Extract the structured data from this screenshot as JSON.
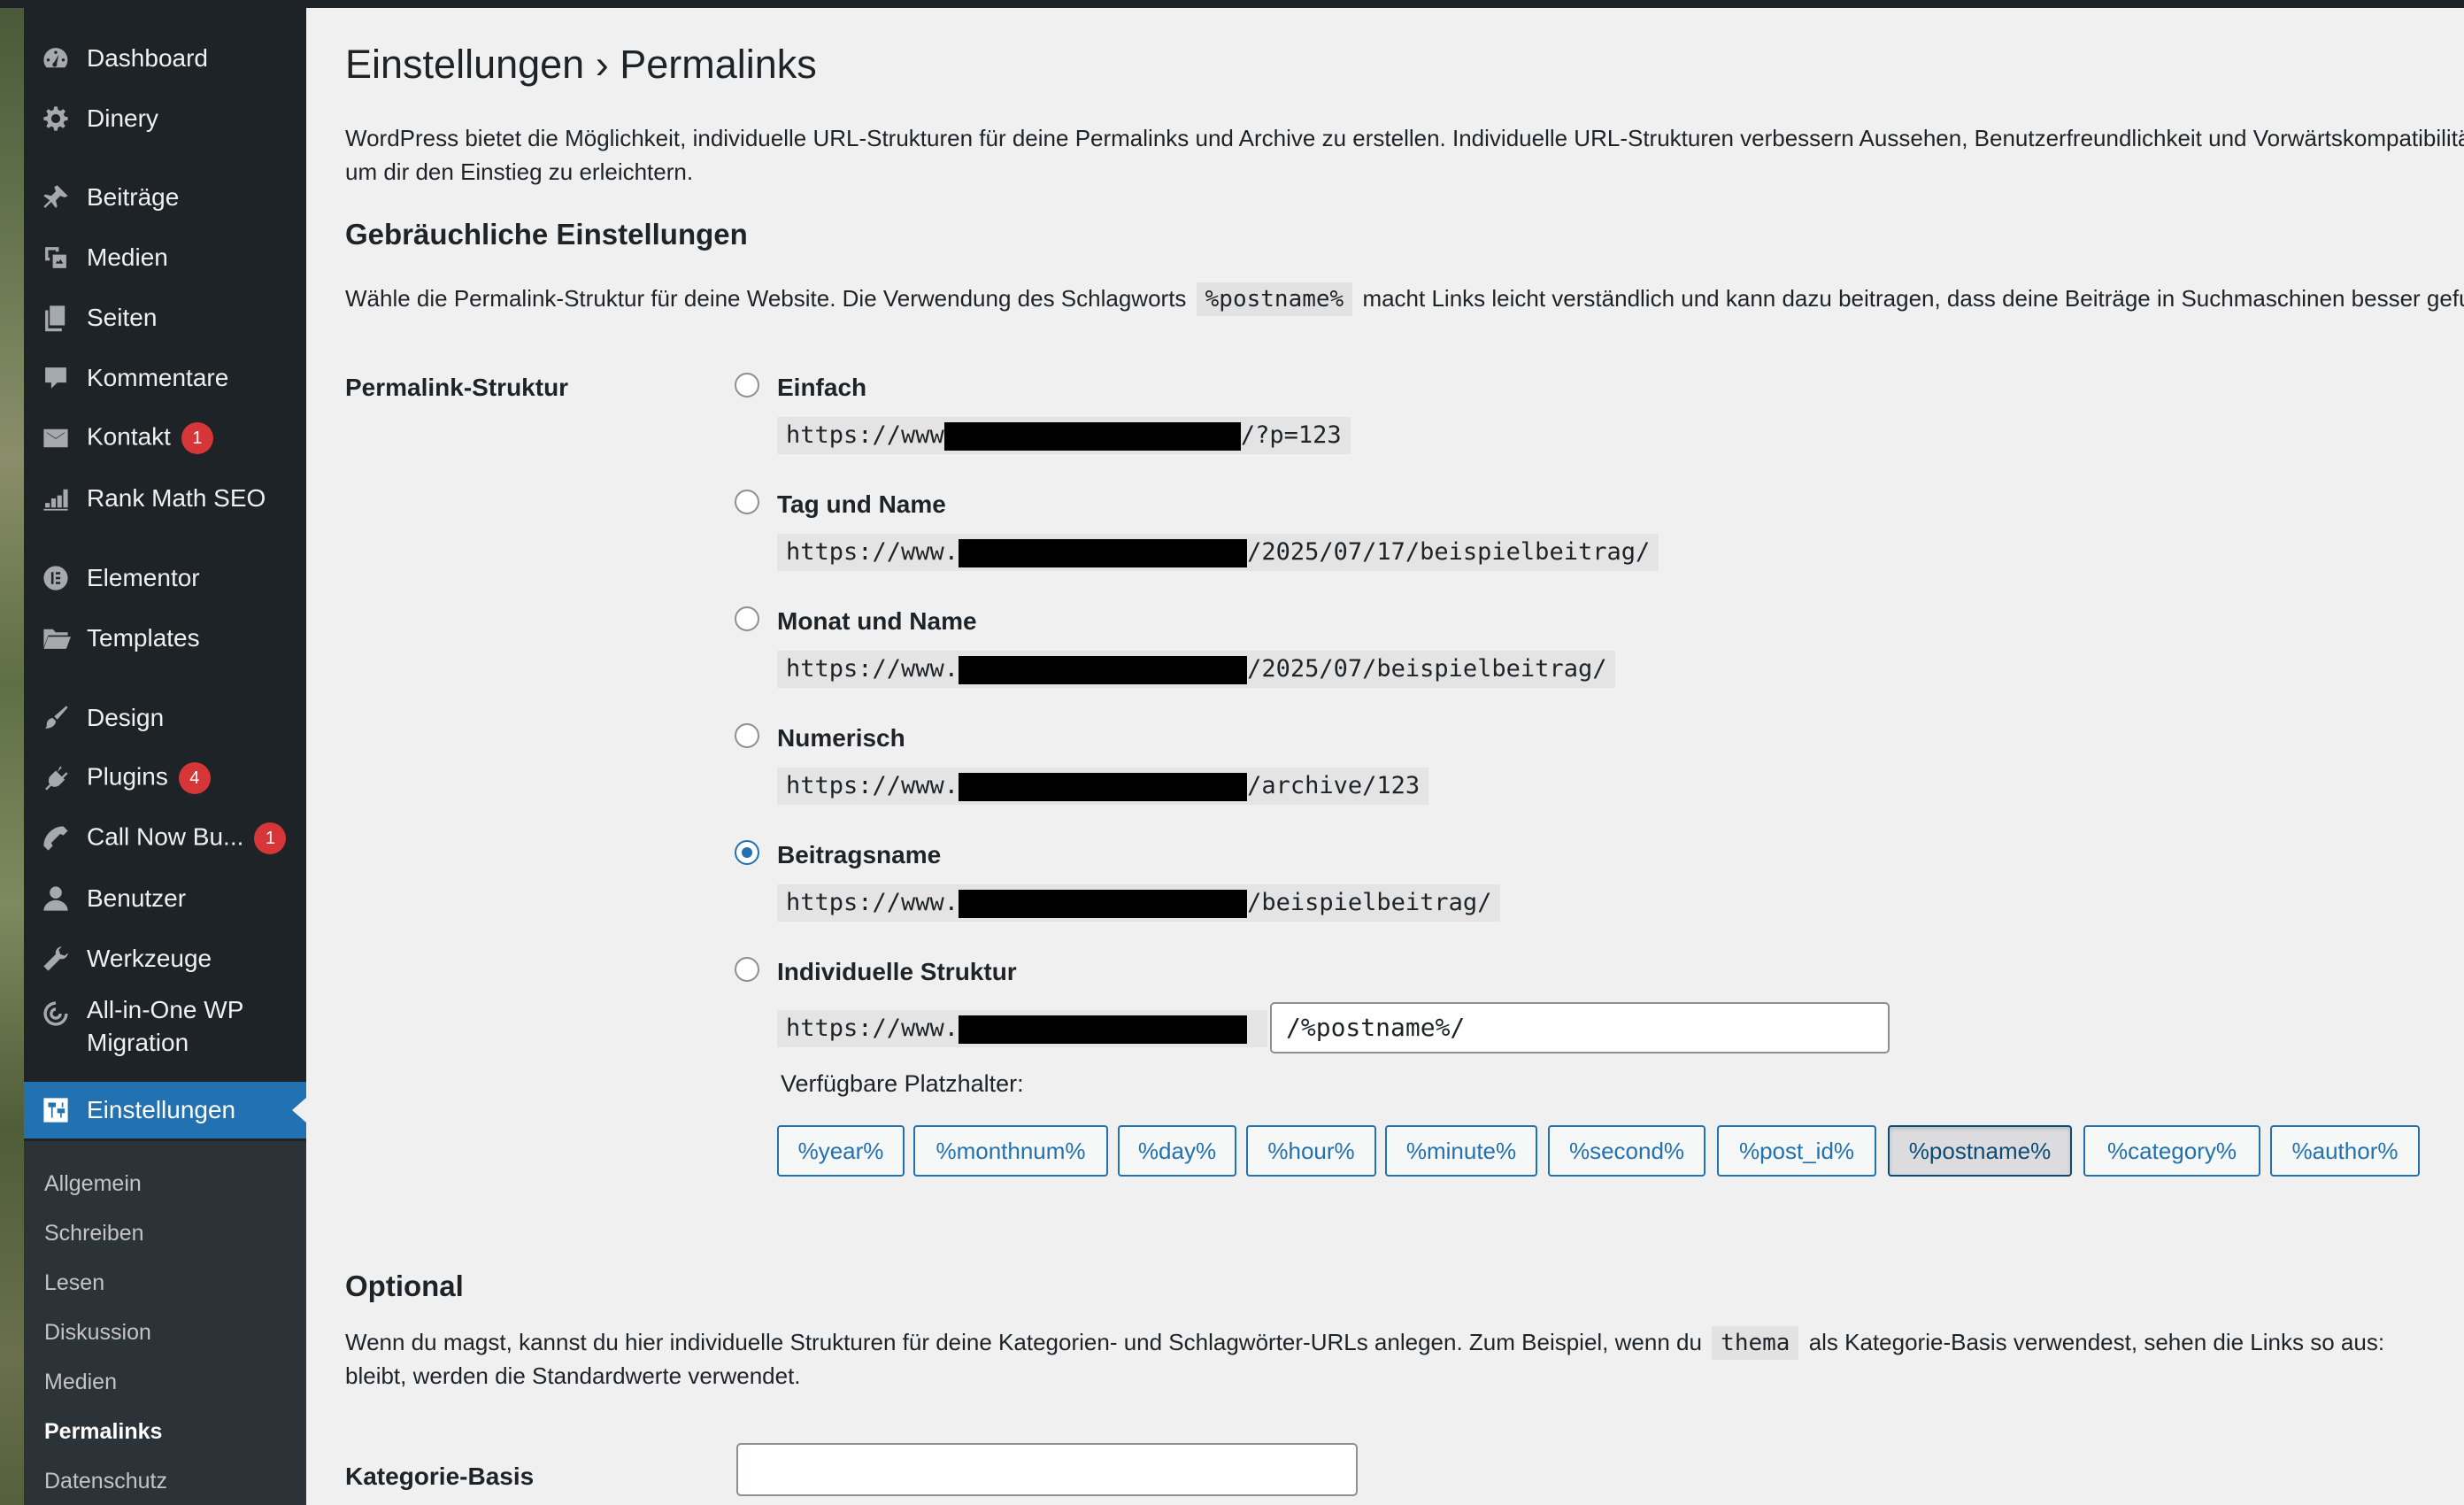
{
  "sidebar": {
    "items": [
      {
        "label": "Dashboard",
        "icon": "dashboard-icon"
      },
      {
        "label": "Dinery",
        "icon": "gear-icon"
      },
      {
        "label": "Beiträge",
        "icon": "pin-icon"
      },
      {
        "label": "Medien",
        "icon": "media-icon"
      },
      {
        "label": "Seiten",
        "icon": "pages-icon"
      },
      {
        "label": "Kommentare",
        "icon": "comment-icon"
      },
      {
        "label": "Kontakt",
        "icon": "mail-icon",
        "badge": "1"
      },
      {
        "label": "Rank Math SEO",
        "icon": "chart-icon"
      },
      {
        "label": "Elementor",
        "icon": "elementor-icon"
      },
      {
        "label": "Templates",
        "icon": "folder-icon"
      },
      {
        "label": "Design",
        "icon": "brush-icon"
      },
      {
        "label": "Plugins",
        "icon": "plugin-icon",
        "badge": "4"
      },
      {
        "label": "Call Now Bu...",
        "icon": "phone-icon",
        "badge": "1"
      },
      {
        "label": "Benutzer",
        "icon": "user-icon"
      },
      {
        "label": "Werkzeuge",
        "icon": "wrench-icon"
      },
      {
        "label": "All-in-One WP Migration",
        "icon": "migration-icon"
      },
      {
        "label": "Einstellungen",
        "icon": "settings-icon"
      }
    ],
    "submenu": [
      "Allgemein",
      "Schreiben",
      "Lesen",
      "Diskussion",
      "Medien",
      "Permalinks",
      "Datenschutz"
    ]
  },
  "page": {
    "title": "Einstellungen › Permalinks",
    "intro_line1": "WordPress bietet die Möglichkeit, individuelle URL-Strukturen für deine Permalinks und Archive zu erstellen. Individuelle URL-Strukturen verbessern Aussehen, Benutzerfreundlichkeit und Vorwärtskompatibilität deiner Links. Es sind einige Platzhalter verfügbar, hier sind ein paar Beispiele,",
    "intro_line2": "um dir den Einstieg zu erleichtern.",
    "common_heading": "Gebräuchliche Einstellungen",
    "common_desc_before": "Wähle die Permalink-Struktur für deine Website. Die Verwendung des Schlagworts",
    "common_desc_code": "%postname%",
    "common_desc_after": "macht Links leicht verständlich und kann dazu beitragen, dass deine Beiträge in Suchmaschinen besser gefunden werden."
  },
  "permalink": {
    "label": "Permalink-Struktur",
    "options": [
      {
        "label": "Einfach",
        "url_prefix": "https://www",
        "url_suffix": "/?p=123",
        "checked": false
      },
      {
        "label": "Tag und Name",
        "url_prefix": "https://www.",
        "url_suffix": "/2025/07/17/beispielbeitrag/",
        "checked": false
      },
      {
        "label": "Monat und Name",
        "url_prefix": "https://www.",
        "url_suffix": "/2025/07/beispielbeitrag/",
        "checked": false
      },
      {
        "label": "Numerisch",
        "url_prefix": "https://www.",
        "url_suffix": "/archive/123",
        "checked": false
      },
      {
        "label": "Beitragsname",
        "url_prefix": "https://www.",
        "url_suffix": "/beispielbeitrag/",
        "checked": true
      },
      {
        "label": "Individuelle Struktur",
        "url_prefix": "https://www.",
        "url_suffix": "",
        "checked": false
      }
    ],
    "custom_value": "/%postname%/",
    "placeholders_label": "Verfügbare Platzhalter:",
    "placeholders": [
      "%year%",
      "%monthnum%",
      "%day%",
      "%hour%",
      "%minute%",
      "%second%",
      "%post_id%",
      "%postname%",
      "%category%",
      "%author%"
    ],
    "active_placeholder": "%postname%"
  },
  "optional": {
    "heading": "Optional",
    "desc_line1_before": "Wenn du magst, kannst du hier individuelle Strukturen für deine Kategorien- und Schlagwörter-URLs anlegen. Zum Beispiel, wenn du",
    "desc_code": "thema",
    "desc_line1_after": "als Kategorie-Basis verwendest, sehen die Links so aus:",
    "desc_line2": "bleibt, werden die Standardwerte verwendet.",
    "category_base_label": "Kategorie-Basis",
    "category_base_value": ""
  },
  "colors": {
    "accent": "#2271b1",
    "sidebar_bg": "#1d2327",
    "badge": "#d63638"
  }
}
